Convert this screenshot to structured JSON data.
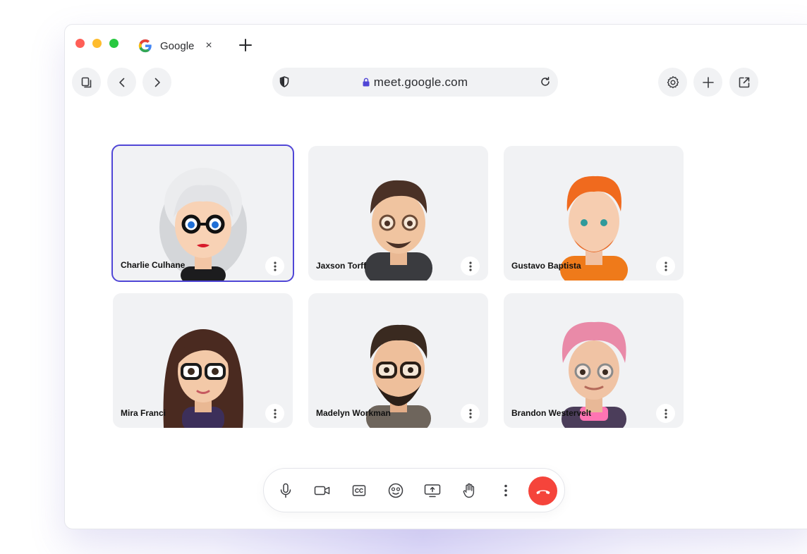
{
  "browser": {
    "tab": {
      "title": "Google",
      "close_glyph": "×",
      "favicon": "google-g-icon"
    },
    "new_tab_icon": "plus-icon",
    "address": {
      "url": "meet.google.com",
      "secure": true
    },
    "nav": {
      "left_icons": [
        "tabs-icon",
        "back-icon",
        "forward-icon"
      ],
      "right_icons": [
        "settings-icon",
        "add-icon",
        "external-link-icon"
      ]
    }
  },
  "participants": [
    {
      "name": "Charlie Culhane",
      "active": true
    },
    {
      "name": "Jaxson Torff",
      "active": false
    },
    {
      "name": "Gustavo Baptista",
      "active": false
    },
    {
      "name": "Mira Franci",
      "active": false
    },
    {
      "name": "Madelyn Workman",
      "active": false
    },
    {
      "name": "Brandon Westervelt",
      "active": false
    }
  ],
  "controls": [
    "microphone-icon",
    "camera-icon",
    "captions-icon",
    "emoji-icon",
    "present-screen-icon",
    "raise-hand-icon",
    "more-vert-icon",
    "end-call-icon"
  ],
  "colors": {
    "accent": "#5046d6",
    "end_call": "#f5443b",
    "tile_bg": "#f1f2f4"
  }
}
